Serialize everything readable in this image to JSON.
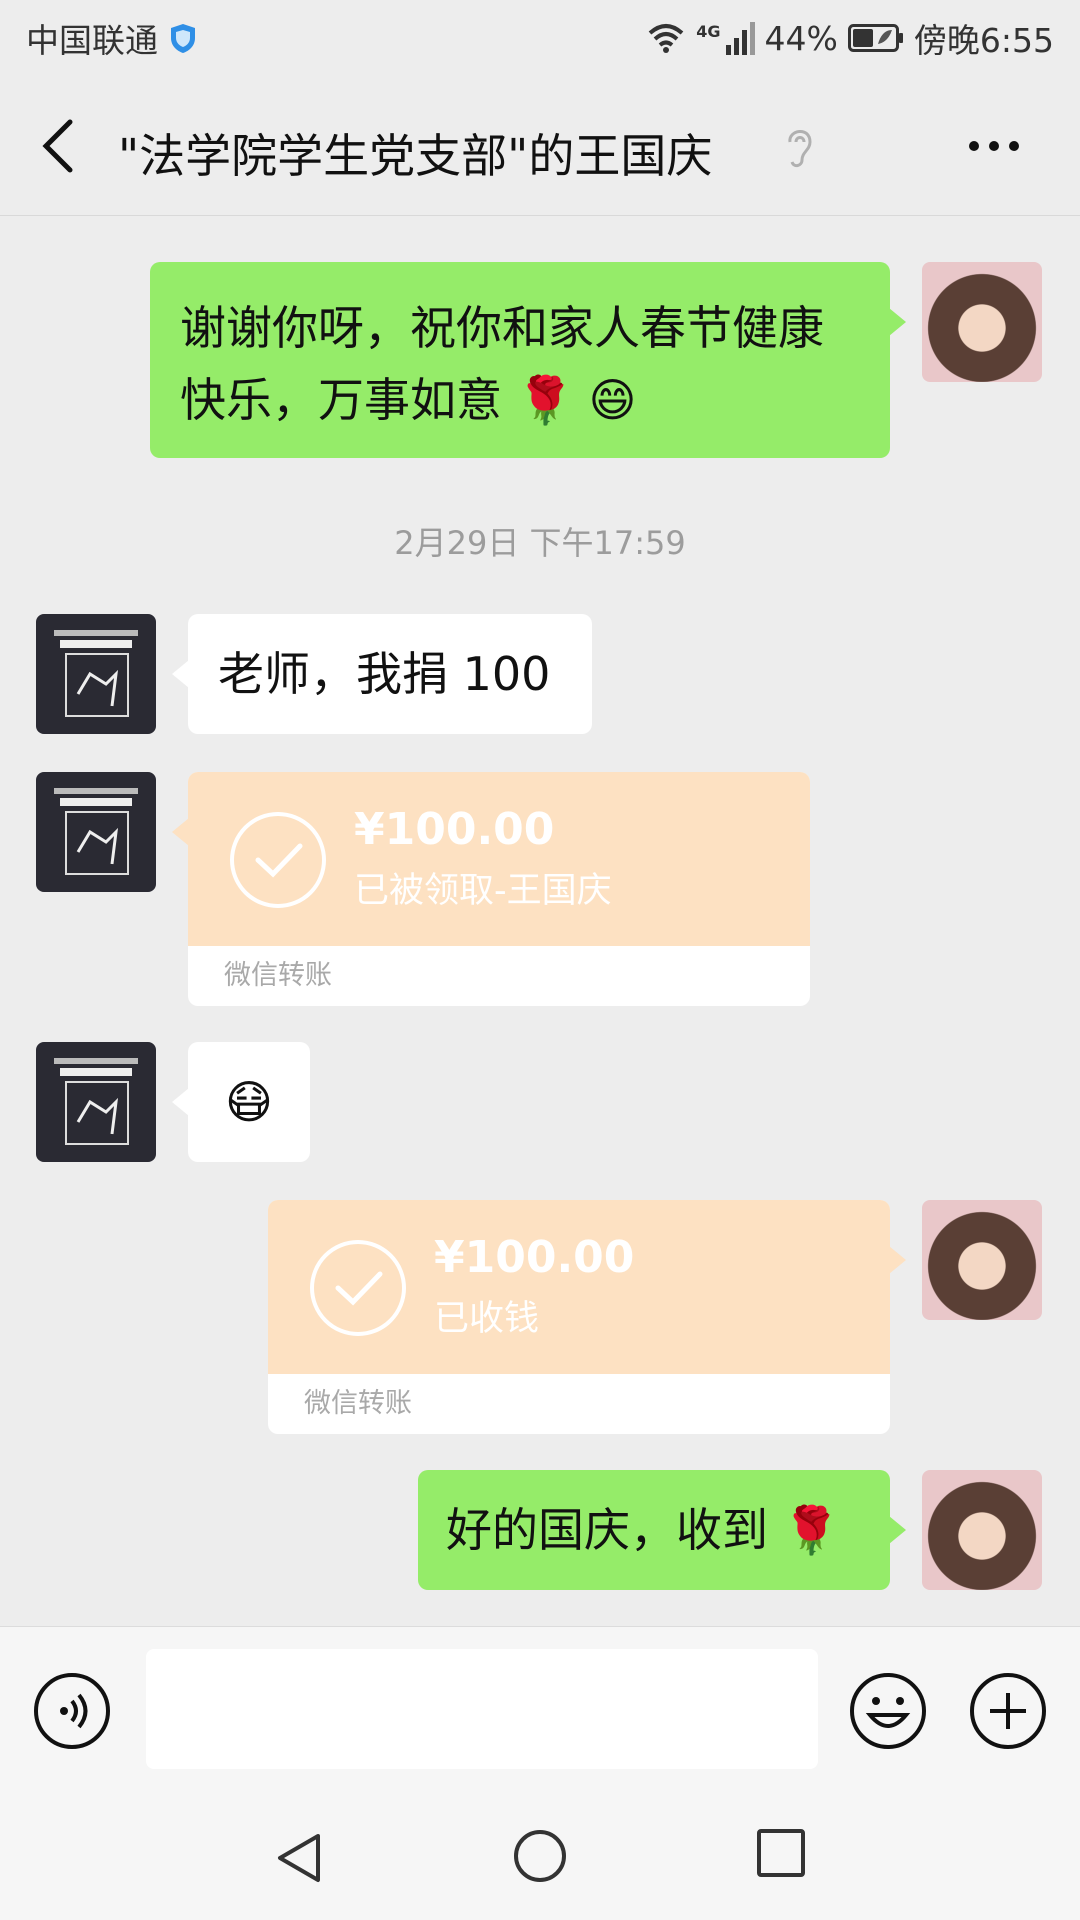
{
  "status_bar": {
    "carrier": "中国联通",
    "network": "4G",
    "battery": "44%",
    "time": "傍晚6:55"
  },
  "header": {
    "title": "\"法学院学生党支部\"的王国庆"
  },
  "messages": {
    "m1": {
      "line1": "谢谢你呀，祝你和家人春节健康",
      "line2": "快乐，万事如意 🌹 😄"
    },
    "timestamp": "2月29日 下午17:59",
    "m2": "老师，我捐 100",
    "t1": {
      "amount": "¥100.00",
      "status": "已被领取-王国庆",
      "footer": "微信转账"
    },
    "m3": "😷",
    "t2": {
      "amount": "¥100.00",
      "status": "已收钱",
      "footer": "微信转账"
    },
    "m4": "好的国庆，收到 🌹"
  },
  "colors": {
    "self_bubble": "#95ec69",
    "other_bubble": "#ffffff",
    "transfer": "#fde1c2",
    "background": "#ededed"
  },
  "icons": [
    "shield-icon",
    "wifi-icon",
    "signal-icon",
    "battery-icon",
    "back-icon",
    "ear-icon",
    "more-icon",
    "check-icon",
    "voice-icon",
    "emoji-icon",
    "plus-icon",
    "nav-back-icon",
    "nav-home-icon",
    "nav-recent-icon"
  ]
}
